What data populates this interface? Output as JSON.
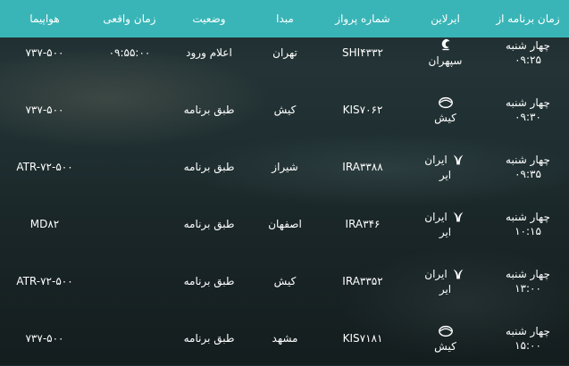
{
  "header": {
    "scheduled_time": "زمان برنامه از",
    "airline": "ایرلاین",
    "flight_number": "شماره پرواز",
    "origin": "مبدا",
    "status": "وضعیت",
    "actual_time": "زمان واقعی",
    "aircraft": "هواپیما"
  },
  "flights": [
    {
      "day": "چهار شنبه",
      "time": "۰۹:۲۵",
      "airline": "سپهران",
      "airline_icon": "sepehran-logo-icon",
      "flight_number": "SHI۴۳۳۲",
      "origin": "تهران",
      "status": "اعلام ورود",
      "actual_time": "۰۹:۵۵:۰۰",
      "aircraft": "۷۳۷-۵۰۰"
    },
    {
      "day": "چهار شنبه",
      "time": "۰۹:۳۰",
      "airline": "کیش",
      "airline_icon": "kish-air-logo-icon",
      "flight_number": "KIS۷۰۶۲",
      "origin": "کیش",
      "status": "طبق برنامه",
      "actual_time": "",
      "aircraft": "۷۳۷-۵۰۰"
    },
    {
      "day": "چهار شنبه",
      "time": "۰۹:۳۵",
      "airline_top": "ایران",
      "airline_bottom": "ایر",
      "airline_icon": "iran-air-logo-icon",
      "flight_number": "IRA۳۳۸۸",
      "origin": "شیراز",
      "status": "طبق برنامه",
      "actual_time": "",
      "aircraft": "ATR-۷۲-۵۰۰"
    },
    {
      "day": "چهار شنبه",
      "time": "۱۰:۱۵",
      "airline_top": "ایران",
      "airline_bottom": "ایر",
      "airline_icon": "iran-air-logo-icon",
      "flight_number": "IRA۳۴۶",
      "origin": "اصفهان",
      "status": "طبق برنامه",
      "actual_time": "",
      "aircraft": "MD۸۲"
    },
    {
      "day": "چهار شنبه",
      "time": "۱۳:۰۰",
      "airline_top": "ایران",
      "airline_bottom": "ایر",
      "airline_icon": "iran-air-logo-icon",
      "flight_number": "IRA۳۳۵۲",
      "origin": "کیش",
      "status": "طبق برنامه",
      "actual_time": "",
      "aircraft": "ATR-۷۲-۵۰۰"
    },
    {
      "day": "چهار شنبه",
      "time": "۱۵:۰۰",
      "airline": "کیش",
      "airline_icon": "kish-air-logo-icon",
      "flight_number": "KIS۷۱۸۱",
      "origin": "مشهد",
      "status": "طبق برنامه",
      "actual_time": "",
      "aircraft": "۷۳۷-۵۰۰"
    }
  ],
  "colors": {
    "header_bg": "#39b5b7",
    "text": "#ffffff"
  }
}
